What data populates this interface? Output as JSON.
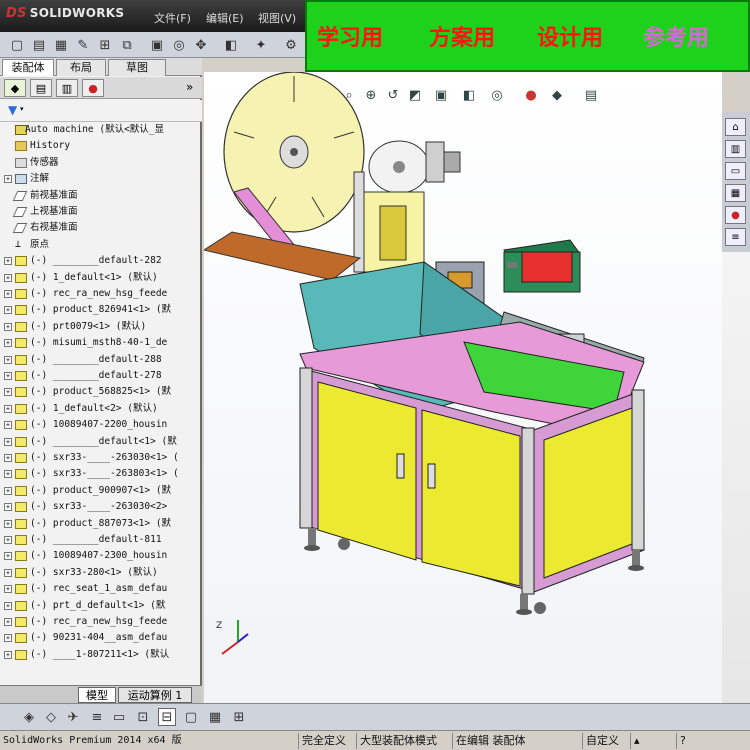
{
  "app": {
    "logo": "SOLIDWORKS",
    "logo_prefix": "DS",
    "menus": [
      "文件(F)",
      "编辑(E)",
      "视图(V)"
    ]
  },
  "banner": {
    "items": [
      "学习用",
      "方案用",
      "设计用",
      "参考用"
    ],
    "colors": {
      "background": "#1ed11a",
      "text": "#ff1414",
      "alt_text": "#d46bd0"
    }
  },
  "left_panel": {
    "tabs": [
      {
        "label": "装配体",
        "active": true
      },
      {
        "label": "布局",
        "active": false
      },
      {
        "label": "草图",
        "active": false
      }
    ],
    "panel_icons": [
      "feature-manager-icon",
      "property-manager-icon",
      "configuration-manager-icon",
      "display-manager-icon"
    ],
    "more": "»",
    "filter_icon": "filter-icon",
    "tree": [
      {
        "label": "Auto machine  (默认<默认_显",
        "icon": "root",
        "expander": ""
      },
      {
        "label": "History",
        "icon": "folder",
        "expander": ""
      },
      {
        "label": "传感器",
        "icon": "sensor",
        "expander": ""
      },
      {
        "label": "注解",
        "icon": "note",
        "expander": "+"
      },
      {
        "label": "前视基准面",
        "icon": "plane",
        "expander": ""
      },
      {
        "label": "上视基准面",
        "icon": "plane",
        "expander": ""
      },
      {
        "label": "右视基准面",
        "icon": "plane",
        "expander": ""
      },
      {
        "label": "原点",
        "icon": "origin",
        "expander": ""
      },
      {
        "label": "(-) ________default-282",
        "icon": "comp",
        "expander": "+"
      },
      {
        "label": "(-) 1_default<1> (默认)",
        "icon": "comp",
        "expander": "+"
      },
      {
        "label": "(-) rec_ra_new_hsg_feede",
        "icon": "comp",
        "expander": "+"
      },
      {
        "label": "(-) product_826941<1> (默",
        "icon": "comp",
        "expander": "+"
      },
      {
        "label": "(-) prt0079<1> (默认)",
        "icon": "comp",
        "expander": "+"
      },
      {
        "label": "(-) misumi_msth8-40-1_de",
        "icon": "comp",
        "expander": "+"
      },
      {
        "label": "(-) ________default-288",
        "icon": "comp",
        "expander": "+"
      },
      {
        "label": "(-) ________default-278",
        "icon": "comp",
        "expander": "+"
      },
      {
        "label": "(-) product_568825<1> (默",
        "icon": "comp",
        "expander": "+"
      },
      {
        "label": "(-) 1_default<2> (默认)",
        "icon": "comp",
        "expander": "+"
      },
      {
        "label": "(-) 10089407-2200_housin",
        "icon": "comp",
        "expander": "+"
      },
      {
        "label": "(-) ________default<1> (默",
        "icon": "comp",
        "expander": "+"
      },
      {
        "label": "(-) sxr33-____-263030<1> (",
        "icon": "comp",
        "expander": "+"
      },
      {
        "label": "(-) sxr33-____-263803<1> (",
        "icon": "comp",
        "expander": "+"
      },
      {
        "label": "(-) product_900907<1> (默",
        "icon": "comp",
        "expander": "+"
      },
      {
        "label": "(-) sxr33-____-263030<2>",
        "icon": "comp",
        "expander": "+"
      },
      {
        "label": "(-) product_887073<1> (默",
        "icon": "comp",
        "expander": "+"
      },
      {
        "label": "(-) ________default-811",
        "icon": "comp",
        "expander": "+"
      },
      {
        "label": "(-) 10089407-2300_housin",
        "icon": "comp",
        "expander": "+"
      },
      {
        "label": "(-) sxr33-280<1> (默认)",
        "icon": "comp",
        "expander": "+"
      },
      {
        "label": "(-) rec_seat_1_asm_defau",
        "icon": "comp",
        "expander": "+"
      },
      {
        "label": "(-) prt_d_default<1> (默",
        "icon": "comp",
        "expander": "+"
      },
      {
        "label": "(-) rec_ra_new_hsg_feede",
        "icon": "comp",
        "expander": "+"
      },
      {
        "label": "(-) 90231-404__asm_defau",
        "icon": "comp",
        "expander": "+"
      },
      {
        "label": "(-) ____1-807211<1> (默认",
        "icon": "comp",
        "expander": "+"
      }
    ],
    "bottom_tabs": [
      {
        "label": "模型",
        "active": true
      },
      {
        "label": "运动算例 1",
        "active": false
      }
    ]
  },
  "viewport_toolbar": [
    "zoom-fit-icon",
    "zoom-area-icon",
    "previous-view-icon",
    "section-view-icon",
    "view-orientation-icon",
    "display-style-icon",
    "hide-show-icon",
    "edit-appearance-icon",
    "apply-scene-icon",
    "view-settings-icon"
  ],
  "taskpane_icons": [
    "resources-icon",
    "design-library-icon",
    "file-explorer-icon",
    "view-palette-icon",
    "appearances-icon",
    "custom-properties-icon"
  ],
  "status": {
    "app": "SolidWorks Premium 2014 x64 版",
    "state": "完全定义",
    "mode": "大型装配体模式",
    "editing": "在编辑 装配体",
    "custom": "自定义"
  }
}
